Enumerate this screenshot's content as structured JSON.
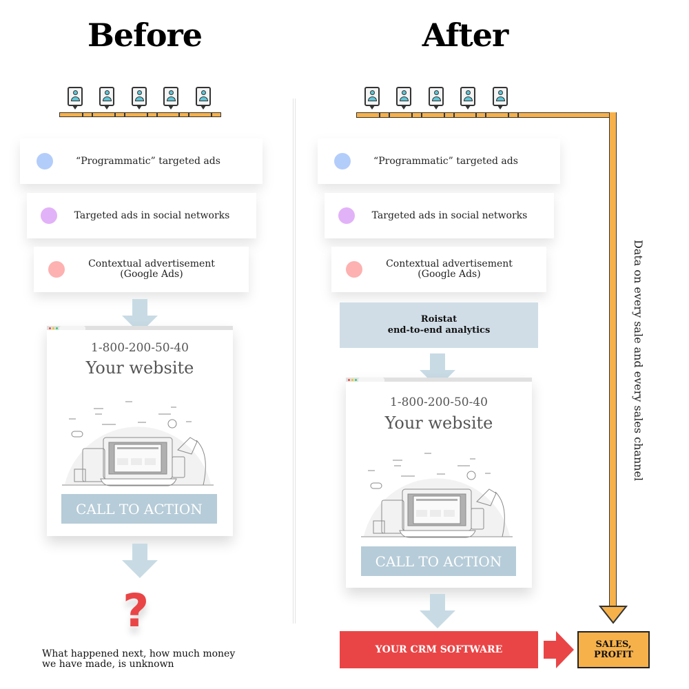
{
  "titles": {
    "before": "Before",
    "after": "After"
  },
  "funnel_items": [
    {
      "label": "“Programmatic” targeted ads",
      "dot_color": "#b3cdfb"
    },
    {
      "label": "Targeted ads in social networks",
      "dot_color": "#e2b2f8"
    },
    {
      "label": "Contextual  advertisement\n(Google Ads)",
      "line1": "Contextual  advertisement",
      "line2": "(Google Ads)",
      "dot_color": "#fdb1b1"
    }
  ],
  "website": {
    "phone": "1-800-200-50-40",
    "name": "Your website",
    "cta": "CALL TO ACTION"
  },
  "before": {
    "question_mark": "?",
    "note_line1": "What happened next, how much money",
    "note_line2": "we have made, is unknown"
  },
  "after": {
    "roistat_line1": "Roistat",
    "roistat_line2": "end-to-end analytics",
    "crm": "YOUR CRM SOFTWARE",
    "sales_line1": "SALES,",
    "sales_line2": "PROFIT",
    "side_label": "Data on every sale and every sales channel"
  },
  "colors": {
    "accent_orange": "#f6b14b",
    "accent_red": "#ea4546",
    "arrow_blue": "#c8dbe5",
    "cta_blue": "#b6ccd8",
    "roistat_bg": "#d0dde6",
    "person_teal": "#5ec5d6"
  },
  "icons": {
    "visitor": "user-pin-icon",
    "arrow": "arrow-down-icon"
  }
}
